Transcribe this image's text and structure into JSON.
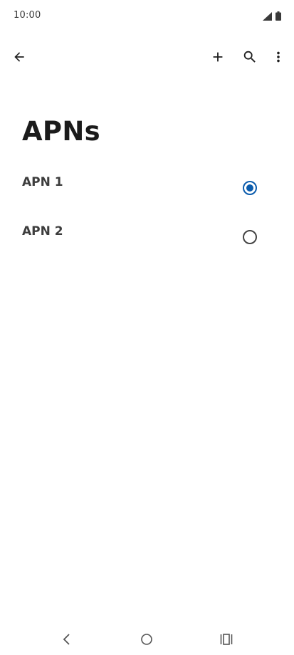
{
  "status_bar": {
    "time": "10:00",
    "icons": [
      "signal-icon",
      "battery-icon"
    ]
  },
  "app_bar": {
    "icons": [
      "back-arrow-icon",
      "plus-icon",
      "search-icon",
      "more-vert-icon"
    ]
  },
  "page": {
    "title": "APNs"
  },
  "apns": [
    {
      "name": "APN 1",
      "selected": true
    },
    {
      "name": "APN 2",
      "selected": false
    }
  ],
  "nav_bar": {
    "icons": [
      "nav-back-icon",
      "nav-home-icon",
      "nav-recents-icon"
    ]
  },
  "colors": {
    "accent": "#0b5cad",
    "text": "#1b1b1b",
    "icon": "#1f1f1f"
  }
}
